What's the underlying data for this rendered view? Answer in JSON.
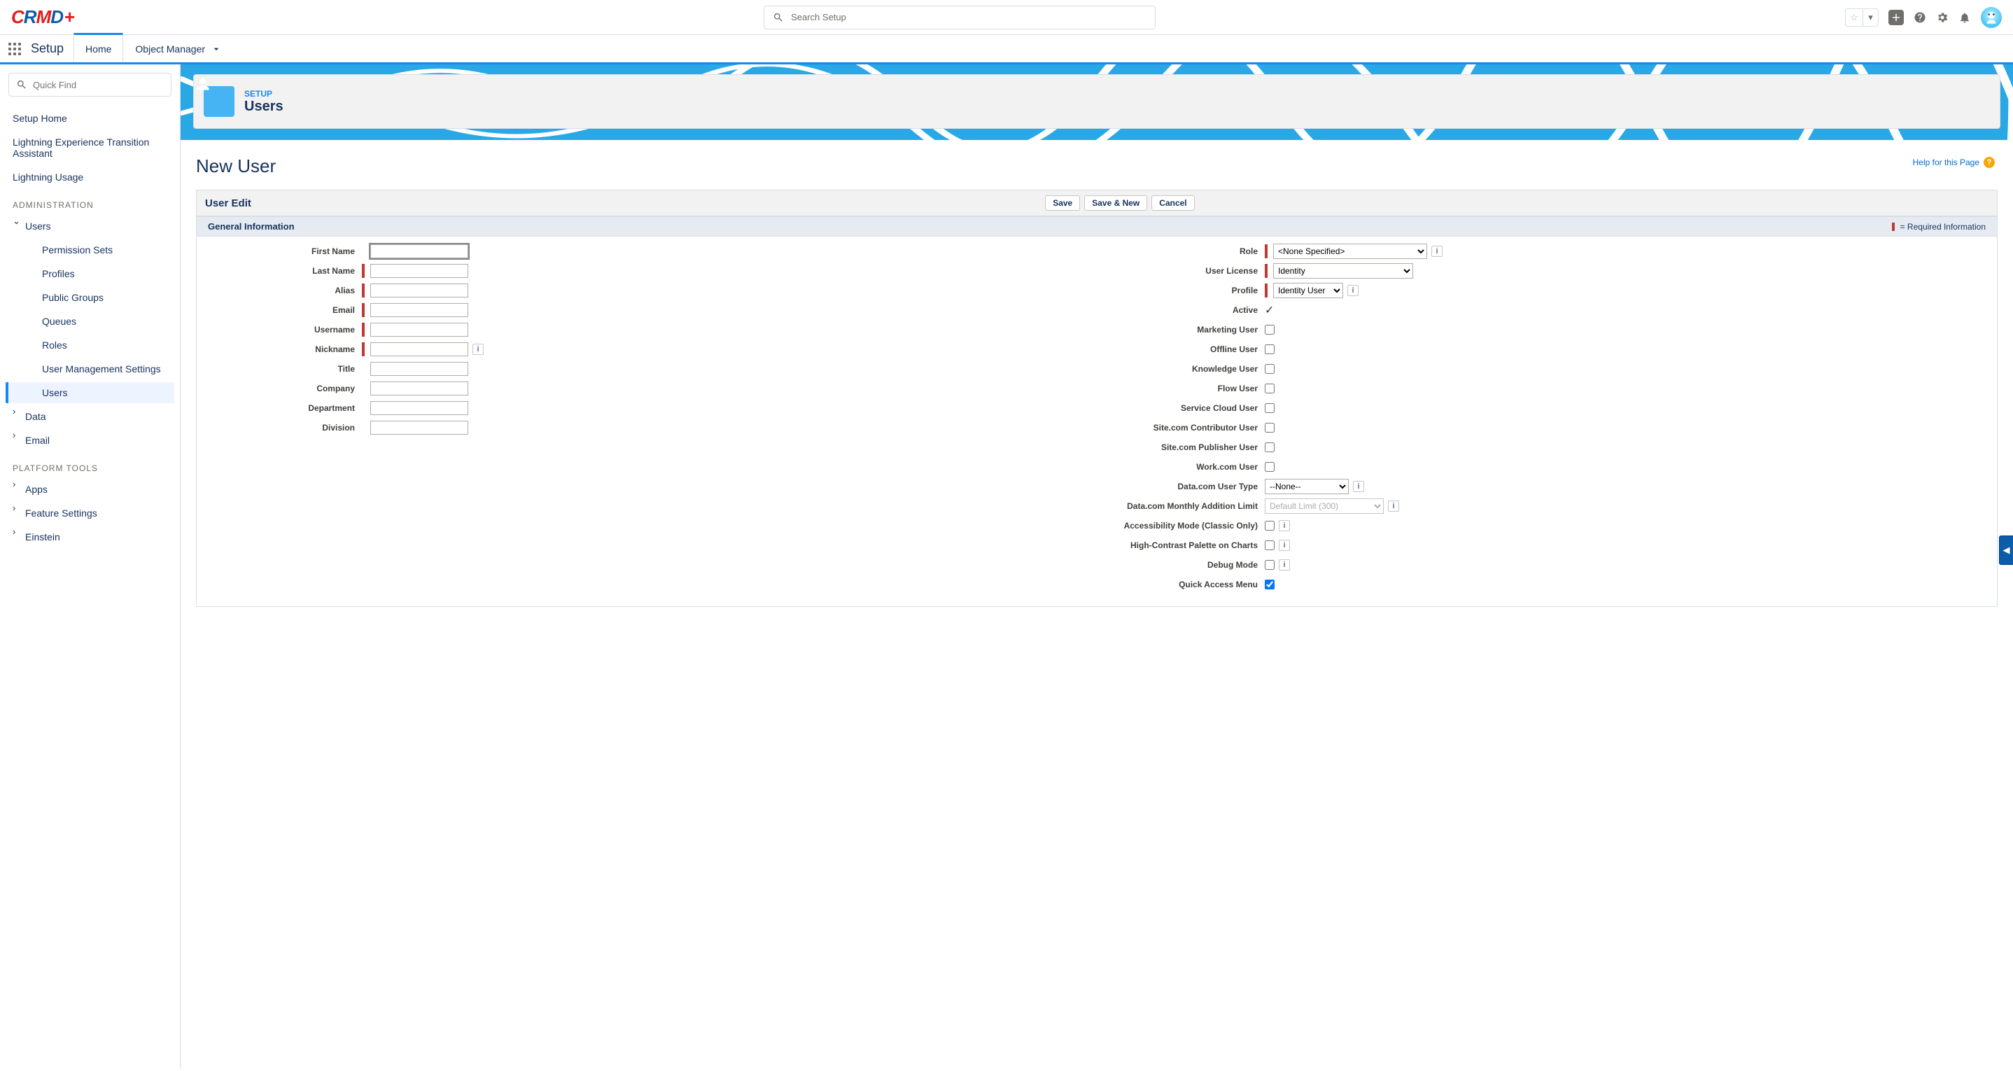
{
  "header": {
    "search_placeholder": "Search Setup"
  },
  "context": {
    "app": "Setup",
    "tabs": {
      "home": "Home",
      "object_manager": "Object Manager"
    }
  },
  "sidebar": {
    "quickfind_placeholder": "Quick Find",
    "items": {
      "setup_home": "Setup Home",
      "transition": "Lightning Experience Transition Assistant",
      "lightning_usage": "Lightning Usage",
      "administration": "ADMINISTRATION",
      "users": "Users",
      "perm_sets": "Permission Sets",
      "profiles": "Profiles",
      "public_groups": "Public Groups",
      "queues": "Queues",
      "roles": "Roles",
      "ums": "User Management Settings",
      "users_sub": "Users",
      "data": "Data",
      "email": "Email",
      "platform_tools": "PLATFORM TOOLS",
      "apps": "Apps",
      "feature_settings": "Feature Settings",
      "einstein": "Einstein"
    }
  },
  "page": {
    "breadcrumb": "SETUP",
    "breadcrumb_title": "Users",
    "heading": "New User",
    "help": "Help for this Page"
  },
  "form": {
    "top_title": "User Edit",
    "buttons": {
      "save": "Save",
      "save_new": "Save & New",
      "cancel": "Cancel"
    },
    "section_title": "General Information",
    "required_label": "= Required Information",
    "labels": {
      "first_name": "First Name",
      "last_name": "Last Name",
      "alias": "Alias",
      "email": "Email",
      "username": "Username",
      "nickname": "Nickname",
      "title": "Title",
      "company": "Company",
      "department": "Department",
      "division": "Division",
      "role": "Role",
      "user_license": "User License",
      "profile": "Profile",
      "active": "Active",
      "marketing_user": "Marketing User",
      "offline_user": "Offline User",
      "knowledge_user": "Knowledge User",
      "flow_user": "Flow User",
      "service_cloud_user": "Service Cloud User",
      "sitecom_contributor": "Site.com Contributor User",
      "sitecom_publisher": "Site.com Publisher User",
      "workcom_user": "Work.com User",
      "datacom_user_type": "Data.com User Type",
      "datacom_limit": "Data.com Monthly Addition Limit",
      "accessibility": "Accessibility Mode (Classic Only)",
      "high_contrast": "High-Contrast Palette on Charts",
      "debug_mode": "Debug Mode",
      "quick_access": "Quick Access Menu"
    },
    "values": {
      "role": "<None Specified>",
      "user_license": "Identity",
      "profile": "Identity User",
      "datacom_user_type": "--None--",
      "datacom_limit": "Default Limit (300)"
    }
  }
}
